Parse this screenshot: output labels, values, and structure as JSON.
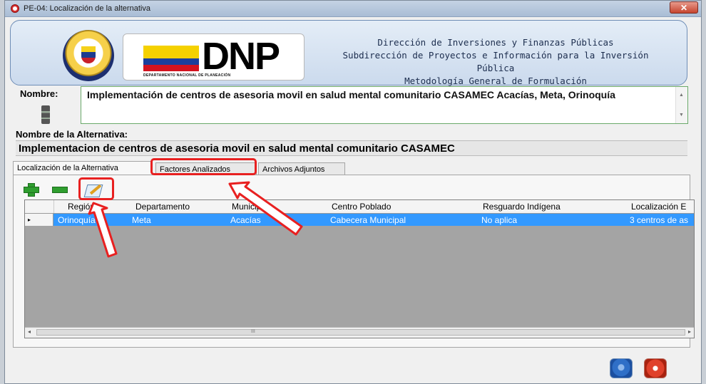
{
  "window": {
    "title": "PE-04: Localización de la alternativa",
    "close_label": "✕"
  },
  "header": {
    "logo_text": "DNP",
    "logo_subtitle": "DEPARTAMENTO NACIONAL DE PLANEACIÓN",
    "line1": "Dirección de Inversiones y Finanzas Públicas",
    "line2": "Subdirección de Proyectos e Información para la Inversión Pública",
    "line3": "Metodología General de Formulación"
  },
  "nombre": {
    "label": "Nombre:",
    "value": "Implementación de centros de asesoria movil en salud mental comunitario CASAMEC Acacías, Meta, Orinoquía"
  },
  "alternativa": {
    "label": "Nombre de la Alternativa:",
    "value": "Implementacion de centros de asesoria movil en salud mental comunitario CASAMEC"
  },
  "tabs": [
    {
      "label": "Localización de la Alternativa",
      "active": true
    },
    {
      "label": "Factores Analizados",
      "active": false
    },
    {
      "label": "Archivos Adjuntos",
      "active": false
    }
  ],
  "toolbar": {
    "add_icon": "plus-icon",
    "remove_icon": "minus-icon",
    "edit_icon": "edit-pencil-icon"
  },
  "grid": {
    "columns": [
      "Región",
      "Departamento",
      "Municipio",
      "Centro Poblado",
      "Resguardo Indígena",
      "Localización E"
    ],
    "rows": [
      [
        "Orinoquía",
        "Meta",
        "Acacías",
        "Cabecera Municipal",
        "No aplica",
        "3 centros de as"
      ]
    ],
    "row_marker": "▸",
    "scroll_left": "◂",
    "scroll_right": "▸",
    "scroll_grip": "III"
  },
  "colors": {
    "annotation": "#e82020",
    "selection": "#3399ff",
    "accent": "#6e8db6"
  }
}
